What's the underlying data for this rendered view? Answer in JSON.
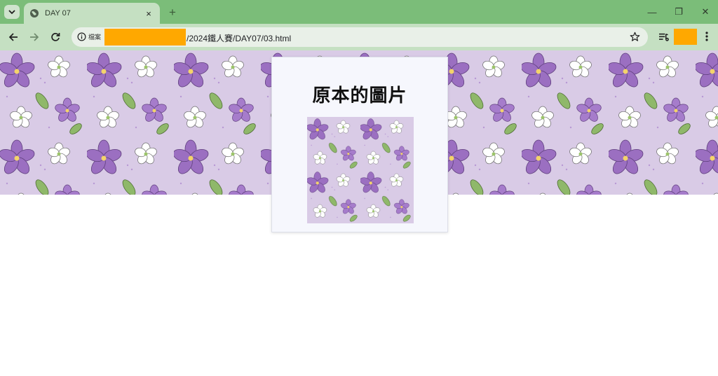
{
  "browser": {
    "tab_title": "DAY 07",
    "new_tab_symbol": "+",
    "close_symbol": "×",
    "site_chip": "檔案",
    "url_tail": "/2024鐵人賽/DAY07/03.html",
    "window_controls": {
      "minimize": "—",
      "restore": "❐",
      "close": "✕"
    }
  },
  "page": {
    "card_title": "原本的圖片"
  },
  "colors": {
    "tabstrip": "#7bbd79",
    "toolbar": "#c5e0c2",
    "redaction": "#ffa800",
    "pattern_bg": "#d9cbe6",
    "flower_purple": "#9b6fc1",
    "leaf_green": "#8fb86a"
  },
  "icons": [
    "tab-search-icon",
    "globe-icon",
    "close-icon",
    "back-arrow-icon",
    "forward-arrow-icon",
    "reload-icon",
    "info-icon",
    "star-icon",
    "reading-list-icon",
    "menu-dots-icon"
  ]
}
